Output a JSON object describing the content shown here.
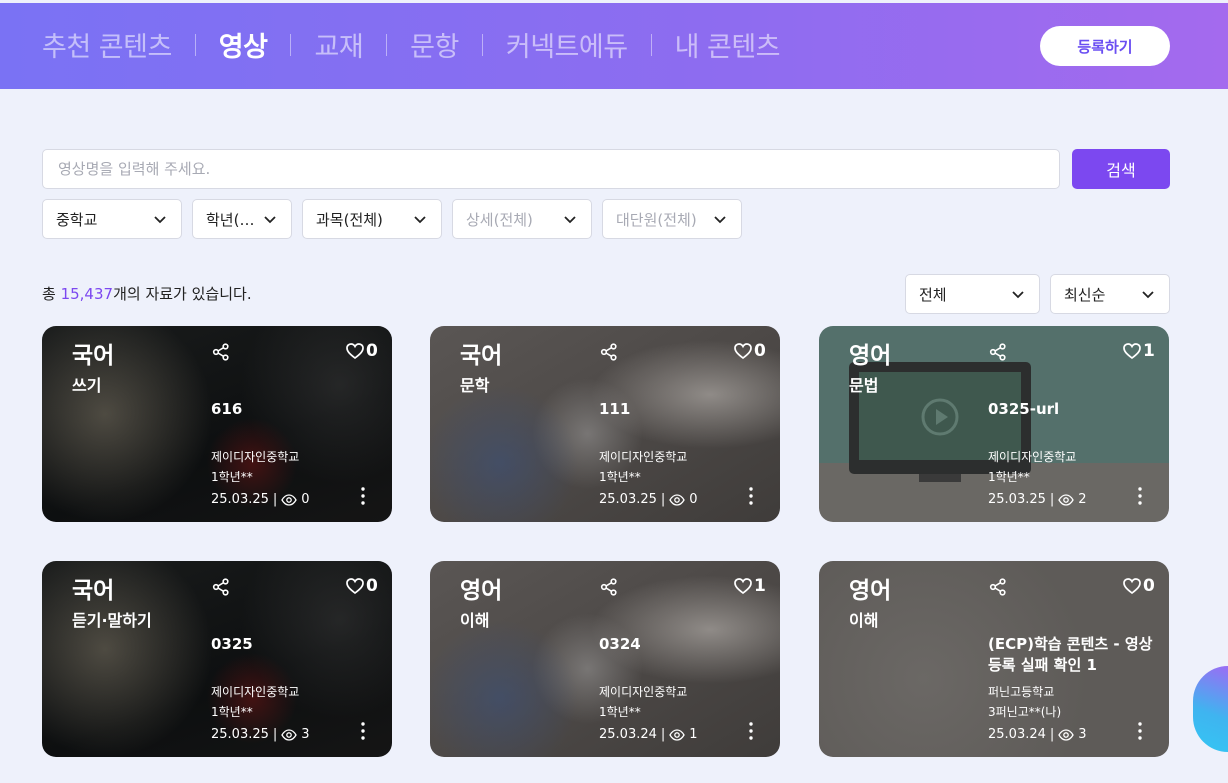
{
  "nav": {
    "items": [
      {
        "label": "추천 콘텐츠",
        "active": false
      },
      {
        "label": "영상",
        "active": true
      },
      {
        "label": "교재",
        "active": false
      },
      {
        "label": "문항",
        "active": false
      },
      {
        "label": "커넥트에듀",
        "active": false
      },
      {
        "label": "내 콘텐츠",
        "active": false
      }
    ],
    "register_label": "등록하기"
  },
  "search": {
    "placeholder": "영상명을 입력해 주세요.",
    "value": "",
    "button_label": "검색"
  },
  "filters": [
    {
      "label": "중학교",
      "disabled": false
    },
    {
      "label": "학년(…",
      "disabled": false
    },
    {
      "label": "과목(전체)",
      "disabled": false
    },
    {
      "label": "상세(전체)",
      "disabled": true
    },
    {
      "label": "대단원(전체)",
      "disabled": true
    }
  ],
  "results": {
    "prefix": "총 ",
    "count": "15,437",
    "suffix": "개의 자료가 있습니다."
  },
  "sort": {
    "scope": "전체",
    "order": "최신순"
  },
  "cards": [
    {
      "subject": "국어",
      "topic": "쓰기",
      "title": "616",
      "school": "제이디자인중학교",
      "grade": "1학년**",
      "date": "25.03.25",
      "views": "0",
      "likes": "0",
      "thumb": "lab"
    },
    {
      "subject": "국어",
      "topic": "문학",
      "title": "111",
      "school": "제이디자인중학교",
      "grade": "1학년**",
      "date": "25.03.25",
      "views": "0",
      "likes": "0",
      "thumb": "micro"
    },
    {
      "subject": "영어",
      "topic": "문법",
      "title": "0325-url",
      "school": "제이디자인중학교",
      "grade": "1학년**",
      "date": "25.03.25",
      "views": "2",
      "likes": "1",
      "thumb": "monitor"
    },
    {
      "subject": "국어",
      "topic": "듣기·말하기",
      "title": "0325",
      "school": "제이디자인중학교",
      "grade": "1학년**",
      "date": "25.03.25",
      "views": "3",
      "likes": "0",
      "thumb": "lab"
    },
    {
      "subject": "영어",
      "topic": "이해",
      "title": "0324",
      "school": "제이디자인중학교",
      "grade": "1학년**",
      "date": "25.03.24",
      "views": "1",
      "likes": "1",
      "thumb": "micro"
    },
    {
      "subject": "영어",
      "topic": "이해",
      "title": "(ECP)학습 콘텐츠 - 영상 등록 실패 확인 1",
      "school": "퍼닌고등학교",
      "grade": "3퍼닌고**(나)",
      "date": "25.03.24",
      "views": "3",
      "likes": "0",
      "thumb": "grey"
    }
  ],
  "colors": {
    "accent": "#7c48f0",
    "header_start": "#7a72f4",
    "header_end": "#a46aee",
    "page_bg": "#eef1fb"
  },
  "icons": [
    "share-icon",
    "heart-icon",
    "eye-icon",
    "more-vertical-icon",
    "chevron-down-icon",
    "play-icon"
  ]
}
